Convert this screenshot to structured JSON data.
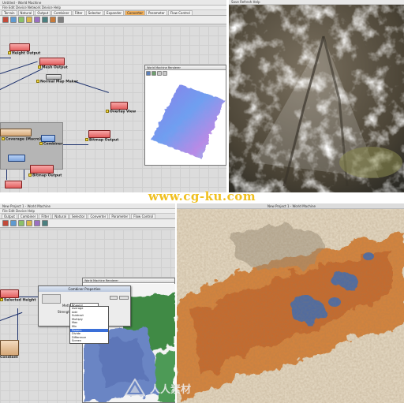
{
  "top_left": {
    "window_title": "Untitled - World Machine",
    "menu": "File  Edit  Device  Network Device  Help",
    "tabs": [
      "Terrain",
      "Natural",
      "Output",
      "Combiner",
      "Filter",
      "Selector",
      "Expander",
      "Converter",
      "Parameter",
      "Flow Control"
    ],
    "active_tab": "Converter",
    "nodes": {
      "height_output": "Height Output",
      "mesh_output": "Mesh Output",
      "normal_map_maker": "Normal Map Maker",
      "overlay_view": "Overlay View",
      "coverage": "Coverage (Macro)",
      "combiner": "Combiner",
      "bitmap_output": "Bitmap Output",
      "bitmap_output_2": "Bitmap Output"
    },
    "preview_title": "World Machine Renderer"
  },
  "top_right": {
    "menu": "Save  Refresh  Help"
  },
  "bottom_left": {
    "window_title": "New Project 1 - World Machine",
    "menu": "File  Edit  Device  Help",
    "tabs": [
      "Output",
      "Combiner",
      "Filter",
      "Natural",
      "Selector",
      "Converter",
      "Parameter",
      "Flow Control"
    ],
    "nodes": {
      "selected_height": "Selected Height",
      "generator": "Constant"
    },
    "preview_title": "World Machine Renderer",
    "dialog": {
      "title": "Combiner Properties",
      "method_label": "Method",
      "method_value": "Powers",
      "strength_label": "Strength",
      "options": [
        "Average",
        "Add",
        "Subtract",
        "Multiply",
        "Max",
        "Min",
        "Powers",
        "Divide",
        "Difference",
        "Screen"
      ],
      "selected_option": "Powers"
    }
  },
  "bottom_right": {
    "window_title": "New Project 1 - World Machine"
  },
  "watermark": "www.cg-ku.com",
  "brand_text": "人人素材",
  "colors": {
    "active_tab": "#f2b15c",
    "node_red": "#e25f5f",
    "watermark": "#f0c020",
    "wire": "#1b2f6b"
  }
}
